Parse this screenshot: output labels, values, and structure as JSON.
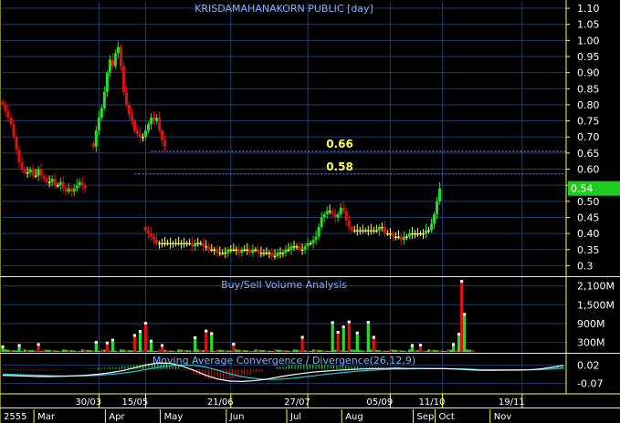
{
  "chart_data": {
    "type": "candlestick",
    "title": "KRISDAMAHANAKORN PUBLIC [day]",
    "colors": {
      "up": "#21e221",
      "down": "#e01010",
      "neutral": "#ffff40",
      "grid": "#1c3f6e",
      "axis": "#ffff40",
      "level_line": "#8d8dff",
      "level_text": "#ffff55",
      "title": "#7fb2ff",
      "last_price_box": "#1fcc1f",
      "macd_line": "#ffffff",
      "signal_line": "#19c8d6",
      "hist_up": "#21e221",
      "hist_down": "#e01010"
    },
    "price_axis": {
      "ticks": [
        "1.10",
        "1.05",
        "1.00",
        "0.95",
        "0.90",
        "0.85",
        "0.80",
        "0.75",
        "0.70",
        "0.65",
        "0.60",
        "0.55",
        "0.50",
        "0.45",
        "0.40",
        "0.35",
        "0.3"
      ],
      "ylim": [
        0.27,
        1.12
      ]
    },
    "last_price": "0.54",
    "levels": [
      {
        "label": "0.66",
        "value": 0.655
      },
      {
        "label": "0.58",
        "value": 0.585
      }
    ],
    "price_segments": [
      {
        "start_day": 0,
        "points": [
          0.8,
          0.78,
          0.76,
          0.74,
          0.7,
          0.66,
          0.62,
          0.6,
          0.59,
          0.59,
          0.6,
          0.58,
          0.58,
          0.6,
          0.58,
          0.57,
          0.56,
          0.56,
          0.57,
          0.55,
          0.55,
          0.56,
          0.54,
          0.53,
          0.54,
          0.53,
          0.54,
          0.55,
          0.56,
          0.55,
          0.54
        ]
      },
      {
        "start_day": 33,
        "points": [
          0.67,
          0.72,
          0.76,
          0.79,
          0.84,
          0.9,
          0.94,
          0.92,
          0.96,
          0.98,
          0.92,
          0.84,
          0.8,
          0.77,
          0.75,
          0.72,
          0.71,
          0.7,
          0.7,
          0.72,
          0.74,
          0.76,
          0.75,
          0.76,
          0.72,
          0.69,
          0.67
        ]
      },
      {
        "start_day": 52,
        "points": [
          0.41,
          0.4,
          0.39,
          0.38,
          0.37,
          0.37,
          0.37,
          0.37,
          0.37,
          0.37,
          0.37,
          0.37,
          0.37,
          0.37,
          0.37,
          0.37,
          0.37,
          0.36,
          0.37,
          0.37,
          0.37,
          0.36,
          0.36,
          0.35,
          0.35,
          0.35,
          0.34,
          0.34,
          0.34,
          0.34,
          0.35,
          0.35,
          0.35,
          0.35,
          0.34,
          0.35,
          0.35,
          0.35,
          0.34,
          0.35,
          0.35,
          0.34,
          0.34,
          0.34,
          0.34,
          0.34,
          0.33,
          0.33,
          0.34,
          0.34,
          0.34,
          0.35,
          0.35,
          0.36,
          0.36,
          0.36,
          0.35,
          0.35,
          0.36,
          0.37,
          0.37,
          0.38,
          0.39,
          0.42,
          0.45,
          0.46,
          0.47,
          0.47,
          0.46,
          0.45,
          0.46,
          0.48,
          0.47,
          0.44,
          0.42,
          0.41,
          0.41,
          0.41,
          0.41,
          0.41,
          0.41,
          0.41,
          0.41,
          0.41,
          0.41,
          0.42,
          0.42,
          0.4,
          0.4,
          0.4,
          0.39,
          0.39,
          0.39,
          0.38,
          0.39,
          0.39,
          0.4,
          0.4,
          0.4,
          0.4,
          0.4,
          0.4,
          0.41,
          0.41,
          0.43,
          0.46,
          0.5,
          0.54
        ]
      }
    ],
    "volume_panel": {
      "title": "Buy/Sell Volume Analysis",
      "ticks": [
        "2,100M",
        "1,500M",
        "900M",
        "300M"
      ],
      "ylim": [
        0,
        2350
      ],
      "bars": [
        {
          "day": 0,
          "value": 120,
          "dir": "up"
        },
        {
          "day": 6,
          "value": 160,
          "dir": "up"
        },
        {
          "day": 13,
          "value": 190,
          "dir": "down"
        },
        {
          "day": 34,
          "value": 260,
          "dir": "up"
        },
        {
          "day": 38,
          "value": 240,
          "dir": "down"
        },
        {
          "day": 40,
          "value": 330,
          "dir": "up"
        },
        {
          "day": 48,
          "value": 480,
          "dir": "down"
        },
        {
          "day": 50,
          "value": 610,
          "dir": "up"
        },
        {
          "day": 52,
          "value": 870,
          "dir": "down"
        },
        {
          "day": 54,
          "value": 300,
          "dir": "up"
        },
        {
          "day": 58,
          "value": 160,
          "dir": "down"
        },
        {
          "day": 70,
          "value": 410,
          "dir": "up"
        },
        {
          "day": 74,
          "value": 620,
          "dir": "down"
        },
        {
          "day": 76,
          "value": 540,
          "dir": "up"
        },
        {
          "day": 84,
          "value": 200,
          "dir": "down"
        },
        {
          "day": 109,
          "value": 420,
          "dir": "down"
        },
        {
          "day": 120,
          "value": 890,
          "dir": "up"
        },
        {
          "day": 122,
          "value": 580,
          "dir": "down"
        },
        {
          "day": 124,
          "value": 750,
          "dir": "up"
        },
        {
          "day": 126,
          "value": 910,
          "dir": "down"
        },
        {
          "day": 129,
          "value": 560,
          "dir": "up"
        },
        {
          "day": 133,
          "value": 900,
          "dir": "up"
        },
        {
          "day": 135,
          "value": 420,
          "dir": "down"
        },
        {
          "day": 149,
          "value": 160,
          "dir": "up"
        },
        {
          "day": 152,
          "value": 170,
          "dir": "down"
        },
        {
          "day": 164,
          "value": 190,
          "dir": "up"
        },
        {
          "day": 166,
          "value": 520,
          "dir": "up"
        },
        {
          "day": 167,
          "value": 2200,
          "dir": "down"
        },
        {
          "day": 168,
          "value": 1150,
          "dir": "up"
        }
      ]
    },
    "macd_panel": {
      "title": "Moving Average Convergence / Divergence(26,12,9)",
      "ticks": [
        "0.02",
        "-0.07"
      ],
      "ylim": [
        -0.12,
        0.07
      ],
      "macd": [
        -0.03,
        -0.032,
        -0.034,
        -0.036,
        -0.036,
        -0.035,
        -0.033,
        -0.03,
        -0.025,
        -0.018,
        -0.008,
        0.005,
        0.02,
        0.03,
        0.028,
        0.015,
        -0.005,
        -0.03,
        -0.048,
        -0.058,
        -0.06,
        -0.057,
        -0.05,
        -0.04,
        -0.03,
        -0.022,
        -0.015,
        -0.01,
        -0.006,
        -0.003,
        0.0,
        0.002,
        0.003,
        0.004,
        0.003,
        0.003,
        0.002,
        0.002,
        0.0,
        -0.003,
        -0.006,
        -0.006,
        -0.005,
        -0.005,
        -0.004,
        0.0,
        0.008,
        0.018
      ],
      "signal": [
        -0.025,
        -0.026,
        -0.028,
        -0.03,
        -0.032,
        -0.033,
        -0.033,
        -0.032,
        -0.03,
        -0.026,
        -0.02,
        -0.012,
        -0.002,
        0.008,
        0.016,
        0.02,
        0.018,
        0.01,
        -0.005,
        -0.022,
        -0.036,
        -0.045,
        -0.05,
        -0.05,
        -0.046,
        -0.04,
        -0.033,
        -0.026,
        -0.02,
        -0.014,
        -0.009,
        -0.005,
        -0.002,
        0.0,
        0.001,
        0.002,
        0.002,
        0.002,
        0.001,
        0.0,
        -0.002,
        -0.003,
        -0.004,
        -0.004,
        -0.004,
        -0.003,
        0.0,
        0.006
      ]
    },
    "x_axis": {
      "date_labels": [
        "30/03",
        "15/05",
        "21/06",
        "27/07",
        "05/09",
        "11/10",
        "19/11"
      ],
      "date_label_days": [
        35,
        52,
        83,
        111,
        141,
        160,
        189
      ],
      "year_label": "2555",
      "month_labels": [
        "Mar",
        "Apr",
        "May",
        "Jun",
        "Jul",
        "Aug",
        "Sep",
        "Oct",
        "Nov"
      ],
      "month_label_days": [
        12,
        38,
        58,
        82,
        104,
        124,
        150,
        158,
        178
      ]
    }
  }
}
